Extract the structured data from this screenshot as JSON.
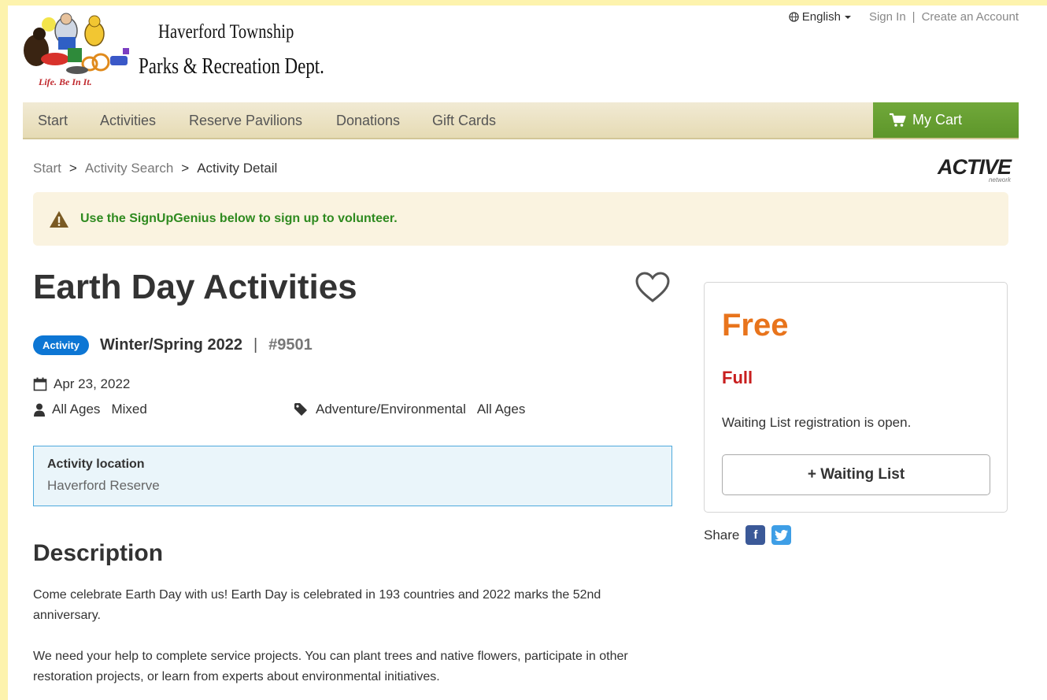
{
  "header": {
    "brand_line1": "Haverford Township",
    "brand_line2": "Parks & Recreation Dept.",
    "tagline": "Life. Be In It.",
    "language": "English",
    "sign_in": "Sign In",
    "separator": "|",
    "create_account": "Create an Account"
  },
  "nav": {
    "items": [
      "Start",
      "Activities",
      "Reserve Pavilions",
      "Donations",
      "Gift Cards"
    ],
    "cart_label": "My Cart"
  },
  "breadcrumb": {
    "items": [
      "Start",
      "Activity Search",
      "Activity Detail"
    ],
    "separator": ">"
  },
  "partner_logo": {
    "main": "ACTIVE",
    "sub": "network"
  },
  "alert": {
    "text": "Use the SignUpGenius below to sign up to volunteer.",
    "icon": "warning-icon"
  },
  "activity": {
    "title": "Earth Day Activities",
    "badge": "Activity",
    "season": "Winter/Spring 2022",
    "divider": "|",
    "number": "#9501",
    "date": "Apr 23, 2022",
    "ages": "All Ages",
    "gender": "Mixed",
    "category": "Adventure/Environmental",
    "category_ages": "All Ages",
    "location_label": "Activity location",
    "location_value": "Haverford Reserve"
  },
  "description": {
    "heading": "Description",
    "paragraphs": [
      "Come celebrate Earth Day with us! Earth Day is celebrated in 193 countries and 2022 marks the 52nd anniversary.",
      "We need your help to complete service projects. You can plant trees and native flowers, participate in other restoration projects, or learn from experts about environmental initiatives."
    ]
  },
  "sidebar": {
    "price": "Free",
    "status": "Full",
    "note": "Waiting List registration is open.",
    "button": "+ Waiting List",
    "share_label": "Share"
  },
  "colors": {
    "page_background": "#fdf3ad",
    "nav_background": "#e9dfba",
    "cart_green": "#66a031",
    "price_orange": "#e8741c",
    "status_red": "#c81e1e",
    "alert_green": "#2e8a1f",
    "badge_blue": "#0d76d4"
  }
}
